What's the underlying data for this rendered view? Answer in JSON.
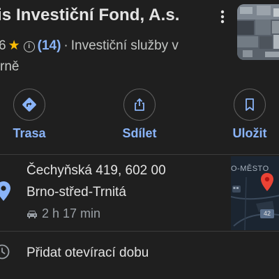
{
  "place": {
    "title": "is Investiční Fond, A.s.",
    "rating_prefix": "6",
    "review_count": "(14)",
    "separator": "·",
    "category": "Investiční služby v",
    "category_cont": "rně"
  },
  "actions": [
    {
      "label": "Trasa",
      "icon": "directions-icon"
    },
    {
      "label": "Sdílet",
      "icon": "share-icon"
    },
    {
      "label": "Uložit",
      "icon": "bookmark-icon"
    }
  ],
  "address": {
    "line1": "Čechyňská 419, 602 00",
    "line2": "Brno-střed-Trnitá",
    "travel_time": "2 h 17 min"
  },
  "map": {
    "district_label": "O-MĚSTO",
    "road_number": "42"
  },
  "hours": {
    "label": "Přidat otevírací dobu"
  },
  "colors": {
    "background": "#1f1f1f",
    "accent": "#8ab4f8",
    "star": "#fbbc04",
    "pin": "#ea4335",
    "text": "#e3e3e3",
    "secondary_text": "#c4c7c5"
  }
}
